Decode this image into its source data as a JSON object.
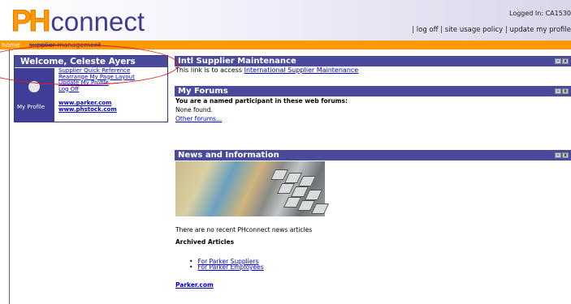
{
  "header": {
    "logo_ph": "PH",
    "logo_connect": "connect",
    "logged_in": "Logged In: CA1530",
    "links": [
      "log off",
      "site usage policy",
      "update my profile"
    ]
  },
  "nav": {
    "home": "home",
    "supplier_management": "supplier management"
  },
  "welcome": {
    "title": "Welcome,  Celeste Ayers",
    "my_profile": "My Profile",
    "links": [
      "Supplier Quick Reference",
      "Rearrange My Page Layout",
      "Update My Profile",
      "Log Off"
    ],
    "external": [
      "www.parker.com",
      "www.phstock.com"
    ]
  },
  "portlets": {
    "intl": {
      "title": "Intl Supplier Maintenance",
      "text": "This link is to access ",
      "link": "International Supplier Maintenance"
    },
    "forums": {
      "title": "My Forums",
      "participant": "You are a named participant in these web forums:",
      "none": "None found.",
      "other": "Other forums..."
    },
    "news": {
      "title": "News and Information",
      "recent": "There are no recent PHconnect news articles",
      "archived": "Archived Articles",
      "articles": [
        "For Parker Suppliers",
        "For Parker Employees"
      ],
      "parker": "Parker.com"
    }
  },
  "controls": {
    "minimize": "–",
    "close": "x"
  },
  "colors": {
    "accent": "#ff9900",
    "bar": "#4a4a9c",
    "annotation": "#e01818"
  }
}
